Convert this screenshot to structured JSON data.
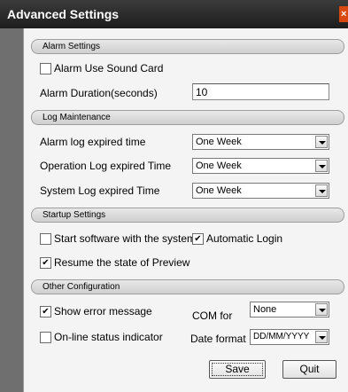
{
  "window": {
    "title": "Advanced Settings",
    "close_glyph": "×"
  },
  "alarm": {
    "header": "Alarm Settings",
    "use_sound_card": {
      "label": "Alarm Use Sound Card",
      "checked": false
    },
    "duration": {
      "label": "Alarm Duration(seconds)",
      "value": "10"
    }
  },
  "log": {
    "header": "Log Maintenance",
    "alarm_log": {
      "label": "Alarm log expired time",
      "value": "One Week"
    },
    "operation_log": {
      "label": "Operation Log expired Time",
      "value": "One Week"
    },
    "system_log": {
      "label": "System Log expired Time",
      "value": "One Week"
    }
  },
  "startup": {
    "header": "Startup Settings",
    "start_with_system": {
      "label": "Start software with the system",
      "checked": false
    },
    "auto_login": {
      "label": "Automatic Login",
      "checked": true
    },
    "resume_preview": {
      "label": "Resume the state of Preview",
      "checked": true
    }
  },
  "other": {
    "header": "Other Configuration",
    "show_error": {
      "label": "Show error message",
      "checked": true
    },
    "online_indicator": {
      "label": "On-line status indicator",
      "checked": false
    },
    "com_for": {
      "label": "COM for",
      "value": "None"
    },
    "date_format": {
      "label": "Date format",
      "value": "DD/MM/YYYY"
    }
  },
  "buttons": {
    "save": "Save",
    "quit": "Quit"
  },
  "check_glyph": "✔"
}
